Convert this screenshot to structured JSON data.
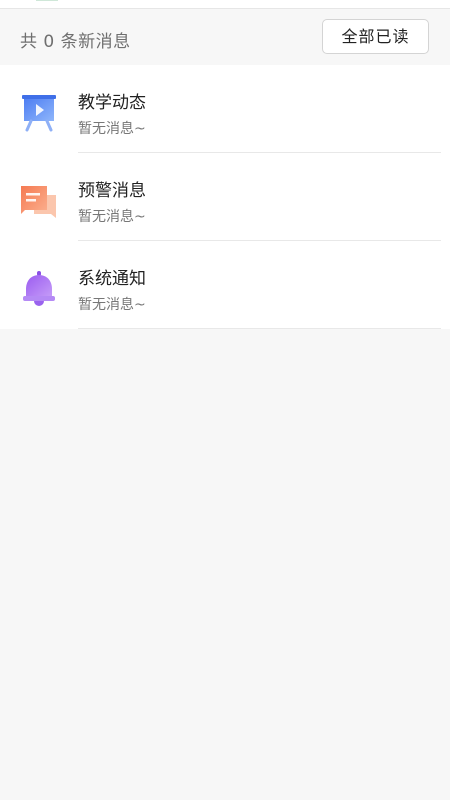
{
  "summary": {
    "text": "共 0 条新消息",
    "read_all_label": "全部已读"
  },
  "items": [
    {
      "title": "教学动态",
      "subtitle": "暂无消息~",
      "icon": "presentation-board-icon",
      "color": "#5b8cf5"
    },
    {
      "title": "预警消息",
      "subtitle": "暂无消息~",
      "icon": "chat-bubble-icon",
      "color": "#f5875b"
    },
    {
      "title": "系统通知",
      "subtitle": "暂无消息~",
      "icon": "bell-icon",
      "color": "#a86df0"
    }
  ]
}
